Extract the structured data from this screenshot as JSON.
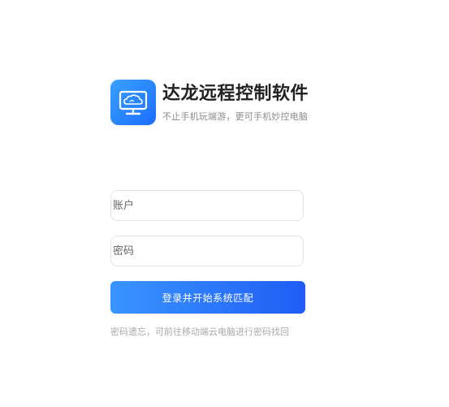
{
  "brand": {
    "title": "达龙远程控制软件",
    "subtitle": "不止手机玩端游，更可手机妙控电脑",
    "logo_icon": "cloud-monitor-icon",
    "logo_colors": [
      "#3aa1ff",
      "#1b6dff"
    ]
  },
  "login_form": {
    "account_placeholder": "账户",
    "password_placeholder": "密码",
    "submit_label": "登录并开始系统匹配",
    "submit_colors": [
      "#3a95ff",
      "#1f5df5"
    ]
  },
  "footer": {
    "password_hint": "密码遗忘，可前往移动端云电脑进行密码找回"
  }
}
